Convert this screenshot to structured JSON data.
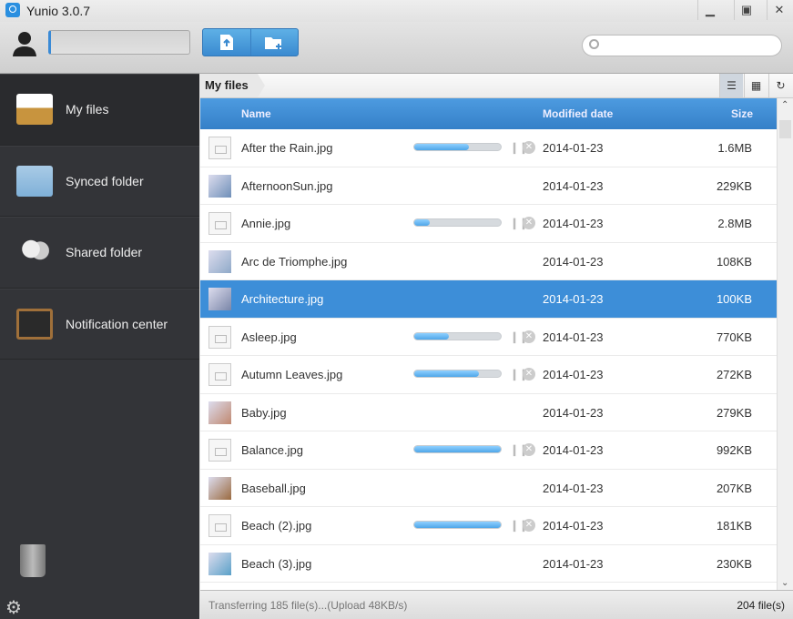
{
  "window": {
    "title": "Yunio 3.0.7",
    "controls": [
      "minimize",
      "restore",
      "close"
    ]
  },
  "toolbar": {
    "user_field_value": "",
    "upload_button": "upload-file",
    "new_folder_button": "new-folder",
    "search_placeholder": ""
  },
  "sidebar": {
    "items": [
      {
        "label": "My files",
        "icon": "inbox-tray-icon",
        "active": true
      },
      {
        "label": "Synced folder",
        "icon": "sync-folder-icon"
      },
      {
        "label": "Shared folder",
        "icon": "users-icon"
      },
      {
        "label": "Notification center",
        "icon": "chalkboard-icon"
      }
    ]
  },
  "breadcrumb": {
    "current": "My files"
  },
  "table": {
    "columns": {
      "name": "Name",
      "modified": "Modified date",
      "size": "Size"
    },
    "rows": [
      {
        "name": "After the Rain.jpg",
        "date": "2014-01-23",
        "size": "1.6MB",
        "progress": 63,
        "thumb": "placeholder"
      },
      {
        "name": "AfternoonSun.jpg",
        "date": "2014-01-23",
        "size": "229KB",
        "thumb": "#6f8fb8"
      },
      {
        "name": "Annie.jpg",
        "date": "2014-01-23",
        "size": "2.8MB",
        "progress": 18,
        "thumb": "placeholder"
      },
      {
        "name": "Arc de Triomphe.jpg",
        "date": "2014-01-23",
        "size": "108KB",
        "thumb": "#8fa9c8"
      },
      {
        "name": "Architecture.jpg",
        "date": "2014-01-23",
        "size": "100KB",
        "thumb": "#7a86a8",
        "selected": true
      },
      {
        "name": "Asleep.jpg",
        "date": "2014-01-23",
        "size": "770KB",
        "progress": 40,
        "thumb": "placeholder"
      },
      {
        "name": "Autumn Leaves.jpg",
        "date": "2014-01-23",
        "size": "272KB",
        "progress": 75,
        "thumb": "placeholder"
      },
      {
        "name": "Baby.jpg",
        "date": "2014-01-23",
        "size": "279KB",
        "thumb": "#c08870"
      },
      {
        "name": "Balance.jpg",
        "date": "2014-01-23",
        "size": "992KB",
        "progress": 100,
        "thumb": "placeholder"
      },
      {
        "name": "Baseball.jpg",
        "date": "2014-01-23",
        "size": "207KB",
        "thumb": "#9a6a40"
      },
      {
        "name": "Beach (2).jpg",
        "date": "2014-01-23",
        "size": "181KB",
        "progress": 100,
        "thumb": "placeholder"
      },
      {
        "name": "Beach (3).jpg",
        "date": "2014-01-23",
        "size": "230KB",
        "thumb": "#5aa0c8"
      }
    ]
  },
  "status": {
    "left": "Transferring 185 file(s)...(Upload 48KB/s)",
    "right": "204 file(s)"
  },
  "colors": {
    "accent": "#3d8ed8",
    "sidebar": "#333438"
  }
}
